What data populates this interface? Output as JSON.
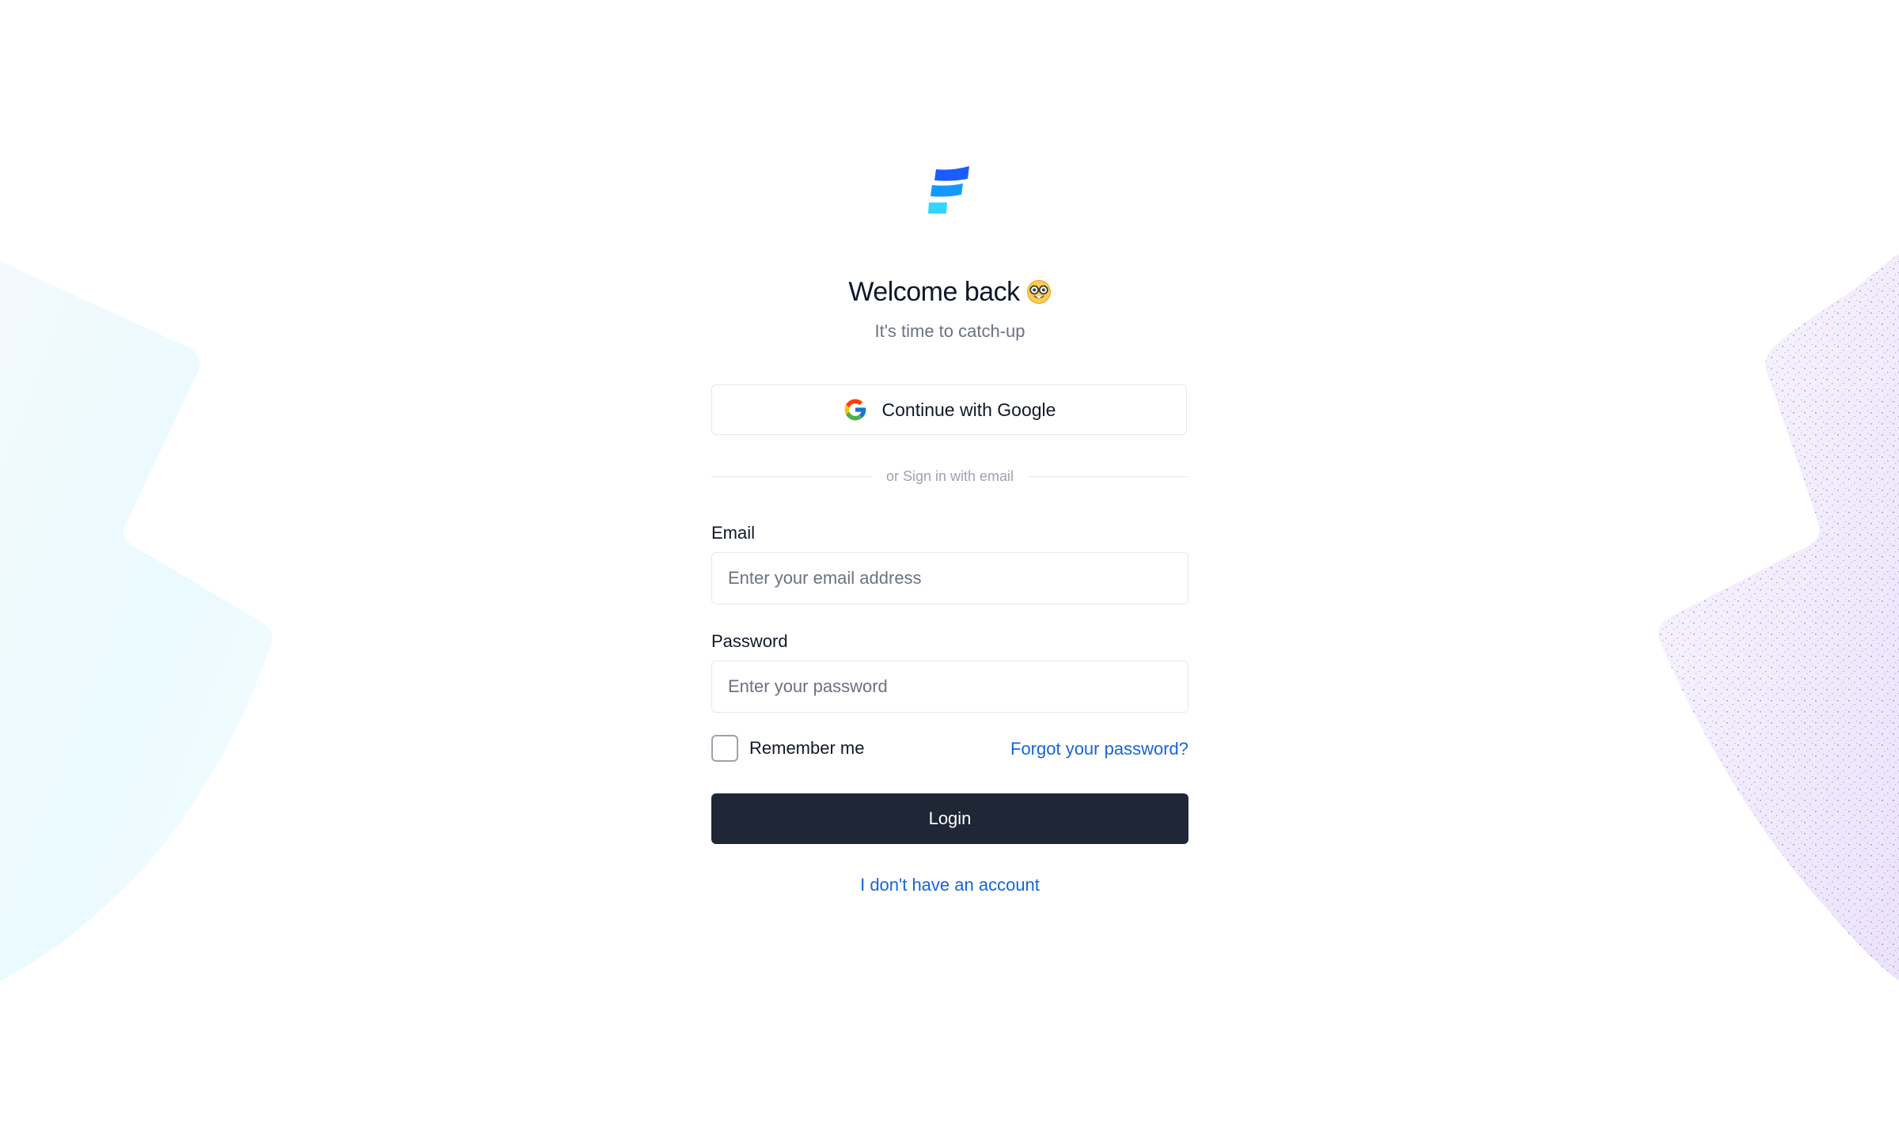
{
  "brand": {
    "logo_icon": "stacked-bars-logo-icon",
    "colors": {
      "top": "#1a5cff",
      "middle": "#1598ff",
      "bottom": "#35d4ff"
    }
  },
  "header": {
    "title": "Welcome back",
    "emoji_icon": "nerd-face-emoji-icon",
    "subtitle": "It's time to catch-up"
  },
  "google": {
    "label": "Continue with Google",
    "icon": "google-g-icon"
  },
  "divider": {
    "text": "or Sign in with email"
  },
  "form": {
    "email": {
      "label": "Email",
      "placeholder": "Enter your email address",
      "value": ""
    },
    "password": {
      "label": "Password",
      "placeholder": "Enter your password",
      "value": ""
    },
    "remember": {
      "label": "Remember me",
      "checked": false
    },
    "forgot_label": "Forgot your password?",
    "login_label": "Login"
  },
  "footer": {
    "signup_label": "I don't have an account"
  },
  "colors": {
    "link": "#1565d8",
    "primary_button": "#1f2636",
    "border": "#e5e7eb",
    "muted_text": "#6b7280"
  }
}
